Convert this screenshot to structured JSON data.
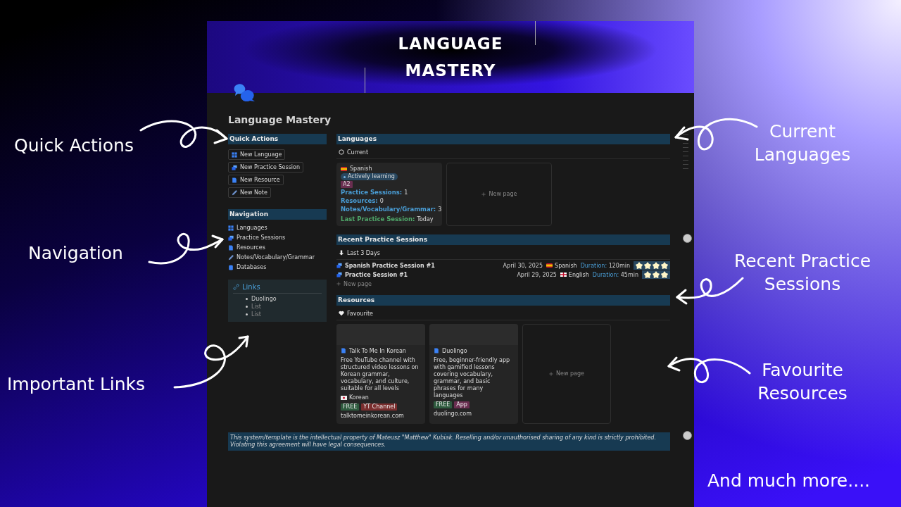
{
  "cover_title": "LANGUAGE MASTERY",
  "page_title": "Language Mastery",
  "quick_actions": {
    "heading": "Quick Actions",
    "buttons": [
      {
        "label": "New Language"
      },
      {
        "label": "New Practice Session"
      },
      {
        "label": "New Resource"
      },
      {
        "label": "New Note"
      }
    ]
  },
  "navigation": {
    "heading": "Navigation",
    "items": [
      {
        "label": "Languages"
      },
      {
        "label": "Practice Sessions"
      },
      {
        "label": "Resources"
      },
      {
        "label": "Notes/Vocabulary/Grammar"
      },
      {
        "label": "Databases"
      }
    ]
  },
  "links": {
    "heading": "Links",
    "items": [
      {
        "label": "Duolingo",
        "kind": "link"
      },
      {
        "label": "List",
        "kind": "placeholder"
      },
      {
        "label": "List",
        "kind": "placeholder"
      }
    ]
  },
  "languages": {
    "heading": "Languages",
    "view_label": "Current",
    "cards": [
      {
        "name": "Spanish",
        "status": "Actively learning",
        "level_tag": "A2",
        "properties": [
          {
            "label": "Practice Sessions:",
            "value": "1",
            "color": "#4a9fd8"
          },
          {
            "label": "Resources:",
            "value": "0",
            "color": "#4a9fd8"
          },
          {
            "label": "Notes/Vocabulary/Grammar:",
            "value": "3",
            "color": "#4a9fd8"
          },
          {
            "label": "Last Practice Session:",
            "value": "Today",
            "color": "#4fa86a"
          }
        ]
      }
    ],
    "new_page": "New page"
  },
  "sessions": {
    "heading": "Recent Practice Sessions",
    "view_label": "Last 3 Days",
    "rows": [
      {
        "title": "Spanish Practice Session #1",
        "date": "April 30, 2025",
        "language": "Spanish",
        "duration_label": "Duration:",
        "duration": "120min",
        "stars": 4
      },
      {
        "title": "Practice Session #1",
        "date": "April 29, 2025",
        "language": "English",
        "duration_label": "Duration:",
        "duration": "45min",
        "stars": 3
      }
    ],
    "new_page": "New page"
  },
  "resources": {
    "heading": "Resources",
    "view_label": "Favourite",
    "cards": [
      {
        "title": "Talk To Me In Korean",
        "description": "Free YouTube channel with structured video lessons on Korean grammar, vocabulary, and culture, suitable for all levels",
        "language": "Korean",
        "tags": [
          {
            "label": "FREE",
            "color": "#2e5a3e"
          },
          {
            "label": "YT Channel",
            "color": "#7a2e2e"
          }
        ],
        "url": "talktomeinkorean.com"
      },
      {
        "title": "Duolingo",
        "description": "Free, beginner-friendly app with gamified lessons covering vocabulary, grammar, and basic phrases for many languages",
        "tags": [
          {
            "label": "FREE",
            "color": "#2e5a3e"
          },
          {
            "label": "App",
            "color": "#6a2e50"
          }
        ],
        "url": "duolingo.com"
      }
    ],
    "new_page": "New page"
  },
  "notice": "This system/template is the intellectual property of Mateusz \"Matthew\" Kubiak. Reselling and/or unauthorised sharing of any kind is strictly prohibited. Violating this agreement will have legal consequences.",
  "annotations": [
    {
      "text": "Quick Actions"
    },
    {
      "text": "Navigation"
    },
    {
      "text": "Important Links"
    },
    {
      "text": "Current Languages"
    },
    {
      "text": "Recent Practice Sessions"
    },
    {
      "text": "Favourite Resources"
    },
    {
      "text": "And much more...."
    }
  ]
}
